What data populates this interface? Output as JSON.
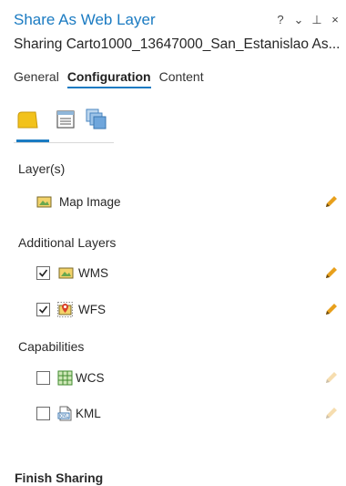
{
  "window": {
    "title": "Share As Web Layer",
    "subtitle": "Sharing Carto1000_13647000_San_Estanislao As...",
    "controls": [
      "?",
      "⌄",
      "⊥",
      "×"
    ]
  },
  "tabs": [
    {
      "label": "General",
      "active": false
    },
    {
      "label": "Configuration",
      "active": true
    },
    {
      "label": "Content",
      "active": false
    }
  ],
  "subtabs": [
    "layers-icon",
    "properties-icon",
    "pages-icon"
  ],
  "layers_section": {
    "heading": "Layer(s)",
    "items": [
      {
        "label": "Map Image",
        "icon": "map-image-icon"
      }
    ]
  },
  "additional_section": {
    "heading": "Additional Layers",
    "items": [
      {
        "label": "WMS",
        "checked": true,
        "icon": "map-image-icon"
      },
      {
        "label": "WFS",
        "checked": true,
        "icon": "feature-icon"
      }
    ]
  },
  "capabilities_section": {
    "heading": "Capabilities",
    "items": [
      {
        "label": "WCS",
        "checked": false,
        "icon": "grid-icon"
      },
      {
        "label": "KML",
        "checked": false,
        "icon": "kml-icon"
      }
    ]
  },
  "finish_section": {
    "heading": "Finish Sharing"
  },
  "colors": {
    "accent": "#1b7bc2",
    "pencil": "#e8a01c"
  }
}
